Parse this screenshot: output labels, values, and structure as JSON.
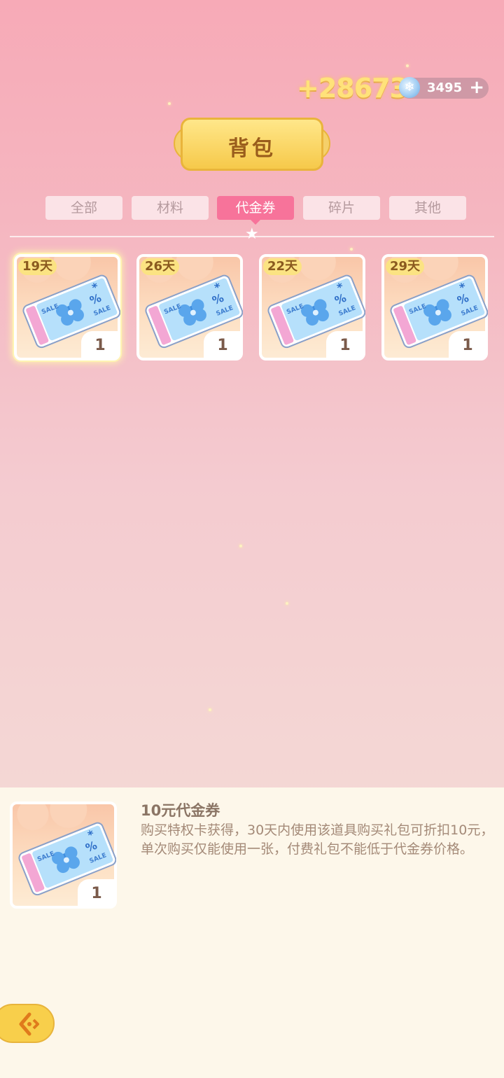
{
  "header": {
    "gold_amount": "+28673",
    "gem_amount": "3495",
    "gem_icon": "snowflake-gem-icon",
    "add_icon": "plus-icon"
  },
  "title": "背包",
  "tabs": [
    {
      "label": "全部",
      "active": false
    },
    {
      "label": "材料",
      "active": false
    },
    {
      "label": "代金券",
      "active": true
    },
    {
      "label": "碎片",
      "active": false
    },
    {
      "label": "其他",
      "active": false
    }
  ],
  "items": [
    {
      "days": "19天",
      "count": "1",
      "selected": true,
      "icon": "voucher-ticket-icon"
    },
    {
      "days": "26天",
      "count": "1",
      "selected": false,
      "icon": "voucher-ticket-icon"
    },
    {
      "days": "22天",
      "count": "1",
      "selected": false,
      "icon": "voucher-ticket-icon"
    },
    {
      "days": "29天",
      "count": "1",
      "selected": false,
      "icon": "voucher-ticket-icon"
    }
  ],
  "detail": {
    "name": "10元代金券",
    "description": "购买特权卡获得，30天内使用该道具购买礼包可折扣10元，单次购买仅能使用一张，付费礼包不能低于代金券价格。",
    "count": "1"
  },
  "colors": {
    "accent_tab": "#f7739a",
    "banner_gold": "#f6c94a",
    "panel_bg": "#fdf7ea"
  }
}
